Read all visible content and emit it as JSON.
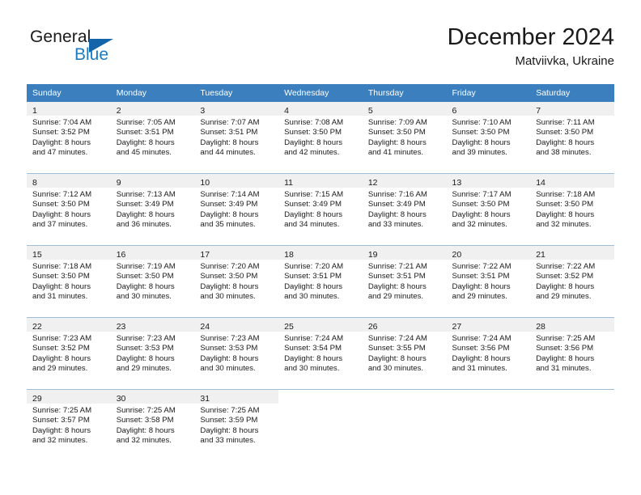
{
  "brand": {
    "name_dark": "General",
    "name_blue": "Blue",
    "accent_color": "#1a7bc4",
    "triangle_color": "#1464aa"
  },
  "header": {
    "title": "December 2024",
    "location": "Matviivka, Ukraine",
    "header_bg": "#3c7fbf",
    "daynum_band_bg": "#f0f0f0"
  },
  "weekdays": [
    "Sunday",
    "Monday",
    "Tuesday",
    "Wednesday",
    "Thursday",
    "Friday",
    "Saturday"
  ],
  "labels": {
    "sunrise_prefix": "Sunrise:",
    "sunset_prefix": "Sunset:",
    "daylight_prefix": "Daylight:"
  },
  "weeks": [
    [
      {
        "day": "1",
        "sunrise": "Sunrise: 7:04 AM",
        "sunset": "Sunset: 3:52 PM",
        "daylight1": "Daylight: 8 hours",
        "daylight2": "and 47 minutes."
      },
      {
        "day": "2",
        "sunrise": "Sunrise: 7:05 AM",
        "sunset": "Sunset: 3:51 PM",
        "daylight1": "Daylight: 8 hours",
        "daylight2": "and 45 minutes."
      },
      {
        "day": "3",
        "sunrise": "Sunrise: 7:07 AM",
        "sunset": "Sunset: 3:51 PM",
        "daylight1": "Daylight: 8 hours",
        "daylight2": "and 44 minutes."
      },
      {
        "day": "4",
        "sunrise": "Sunrise: 7:08 AM",
        "sunset": "Sunset: 3:50 PM",
        "daylight1": "Daylight: 8 hours",
        "daylight2": "and 42 minutes."
      },
      {
        "day": "5",
        "sunrise": "Sunrise: 7:09 AM",
        "sunset": "Sunset: 3:50 PM",
        "daylight1": "Daylight: 8 hours",
        "daylight2": "and 41 minutes."
      },
      {
        "day": "6",
        "sunrise": "Sunrise: 7:10 AM",
        "sunset": "Sunset: 3:50 PM",
        "daylight1": "Daylight: 8 hours",
        "daylight2": "and 39 minutes."
      },
      {
        "day": "7",
        "sunrise": "Sunrise: 7:11 AM",
        "sunset": "Sunset: 3:50 PM",
        "daylight1": "Daylight: 8 hours",
        "daylight2": "and 38 minutes."
      }
    ],
    [
      {
        "day": "8",
        "sunrise": "Sunrise: 7:12 AM",
        "sunset": "Sunset: 3:50 PM",
        "daylight1": "Daylight: 8 hours",
        "daylight2": "and 37 minutes."
      },
      {
        "day": "9",
        "sunrise": "Sunrise: 7:13 AM",
        "sunset": "Sunset: 3:49 PM",
        "daylight1": "Daylight: 8 hours",
        "daylight2": "and 36 minutes."
      },
      {
        "day": "10",
        "sunrise": "Sunrise: 7:14 AM",
        "sunset": "Sunset: 3:49 PM",
        "daylight1": "Daylight: 8 hours",
        "daylight2": "and 35 minutes."
      },
      {
        "day": "11",
        "sunrise": "Sunrise: 7:15 AM",
        "sunset": "Sunset: 3:49 PM",
        "daylight1": "Daylight: 8 hours",
        "daylight2": "and 34 minutes."
      },
      {
        "day": "12",
        "sunrise": "Sunrise: 7:16 AM",
        "sunset": "Sunset: 3:49 PM",
        "daylight1": "Daylight: 8 hours",
        "daylight2": "and 33 minutes."
      },
      {
        "day": "13",
        "sunrise": "Sunrise: 7:17 AM",
        "sunset": "Sunset: 3:50 PM",
        "daylight1": "Daylight: 8 hours",
        "daylight2": "and 32 minutes."
      },
      {
        "day": "14",
        "sunrise": "Sunrise: 7:18 AM",
        "sunset": "Sunset: 3:50 PM",
        "daylight1": "Daylight: 8 hours",
        "daylight2": "and 32 minutes."
      }
    ],
    [
      {
        "day": "15",
        "sunrise": "Sunrise: 7:18 AM",
        "sunset": "Sunset: 3:50 PM",
        "daylight1": "Daylight: 8 hours",
        "daylight2": "and 31 minutes."
      },
      {
        "day": "16",
        "sunrise": "Sunrise: 7:19 AM",
        "sunset": "Sunset: 3:50 PM",
        "daylight1": "Daylight: 8 hours",
        "daylight2": "and 30 minutes."
      },
      {
        "day": "17",
        "sunrise": "Sunrise: 7:20 AM",
        "sunset": "Sunset: 3:50 PM",
        "daylight1": "Daylight: 8 hours",
        "daylight2": "and 30 minutes."
      },
      {
        "day": "18",
        "sunrise": "Sunrise: 7:20 AM",
        "sunset": "Sunset: 3:51 PM",
        "daylight1": "Daylight: 8 hours",
        "daylight2": "and 30 minutes."
      },
      {
        "day": "19",
        "sunrise": "Sunrise: 7:21 AM",
        "sunset": "Sunset: 3:51 PM",
        "daylight1": "Daylight: 8 hours",
        "daylight2": "and 29 minutes."
      },
      {
        "day": "20",
        "sunrise": "Sunrise: 7:22 AM",
        "sunset": "Sunset: 3:51 PM",
        "daylight1": "Daylight: 8 hours",
        "daylight2": "and 29 minutes."
      },
      {
        "day": "21",
        "sunrise": "Sunrise: 7:22 AM",
        "sunset": "Sunset: 3:52 PM",
        "daylight1": "Daylight: 8 hours",
        "daylight2": "and 29 minutes."
      }
    ],
    [
      {
        "day": "22",
        "sunrise": "Sunrise: 7:23 AM",
        "sunset": "Sunset: 3:52 PM",
        "daylight1": "Daylight: 8 hours",
        "daylight2": "and 29 minutes."
      },
      {
        "day": "23",
        "sunrise": "Sunrise: 7:23 AM",
        "sunset": "Sunset: 3:53 PM",
        "daylight1": "Daylight: 8 hours",
        "daylight2": "and 29 minutes."
      },
      {
        "day": "24",
        "sunrise": "Sunrise: 7:23 AM",
        "sunset": "Sunset: 3:53 PM",
        "daylight1": "Daylight: 8 hours",
        "daylight2": "and 30 minutes."
      },
      {
        "day": "25",
        "sunrise": "Sunrise: 7:24 AM",
        "sunset": "Sunset: 3:54 PM",
        "daylight1": "Daylight: 8 hours",
        "daylight2": "and 30 minutes."
      },
      {
        "day": "26",
        "sunrise": "Sunrise: 7:24 AM",
        "sunset": "Sunset: 3:55 PM",
        "daylight1": "Daylight: 8 hours",
        "daylight2": "and 30 minutes."
      },
      {
        "day": "27",
        "sunrise": "Sunrise: 7:24 AM",
        "sunset": "Sunset: 3:56 PM",
        "daylight1": "Daylight: 8 hours",
        "daylight2": "and 31 minutes."
      },
      {
        "day": "28",
        "sunrise": "Sunrise: 7:25 AM",
        "sunset": "Sunset: 3:56 PM",
        "daylight1": "Daylight: 8 hours",
        "daylight2": "and 31 minutes."
      }
    ],
    [
      {
        "day": "29",
        "sunrise": "Sunrise: 7:25 AM",
        "sunset": "Sunset: 3:57 PM",
        "daylight1": "Daylight: 8 hours",
        "daylight2": "and 32 minutes."
      },
      {
        "day": "30",
        "sunrise": "Sunrise: 7:25 AM",
        "sunset": "Sunset: 3:58 PM",
        "daylight1": "Daylight: 8 hours",
        "daylight2": "and 32 minutes."
      },
      {
        "day": "31",
        "sunrise": "Sunrise: 7:25 AM",
        "sunset": "Sunset: 3:59 PM",
        "daylight1": "Daylight: 8 hours",
        "daylight2": "and 33 minutes."
      },
      {
        "day": "",
        "sunrise": "",
        "sunset": "",
        "daylight1": "",
        "daylight2": ""
      },
      {
        "day": "",
        "sunrise": "",
        "sunset": "",
        "daylight1": "",
        "daylight2": ""
      },
      {
        "day": "",
        "sunrise": "",
        "sunset": "",
        "daylight1": "",
        "daylight2": ""
      },
      {
        "day": "",
        "sunrise": "",
        "sunset": "",
        "daylight1": "",
        "daylight2": ""
      }
    ]
  ]
}
